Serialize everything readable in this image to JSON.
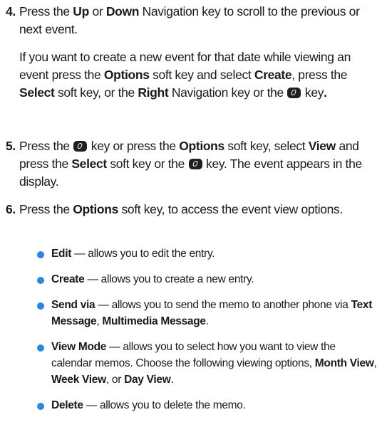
{
  "step4": {
    "num": "4.",
    "t1": "Press the ",
    "b1": "Up",
    "t2": " or ",
    "b2": "Down",
    "t3": " Navigation key to scroll to the previous or next event."
  },
  "step4_para": {
    "t1": "If you want to create a new event for that date while viewing an event press the ",
    "b1": "Options",
    "t2": " soft key and select ",
    "b2": "Create",
    "t3": ", press the ",
    "b3": "Select",
    "t4": " soft key, or the ",
    "b4": "Right",
    "t5": " Navigation key or the ",
    "t6": " key",
    "t7": "."
  },
  "step5": {
    "num": "5.",
    "t1": "Press the ",
    "t2": " key or press the ",
    "b1": "Options",
    "t3": " soft key, select ",
    "b2": "View",
    "t4": " and press the ",
    "b3": "Select",
    "t5": " soft key or the ",
    "t6": " key. The event appears in the display."
  },
  "step6": {
    "num": "6.",
    "t1": "Press the ",
    "b1": "Options",
    "t2": " soft key, to access the event view options."
  },
  "bullets": {
    "edit": {
      "b1": "Edit",
      "t1": " — allows you to edit the entry."
    },
    "create": {
      "b1": "Create",
      "t1": " — allows you to create a new entry."
    },
    "send": {
      "b1": "Send via",
      "t1": " — allows you to send the memo to another phone via ",
      "b2": "Text Message",
      "t2": ", ",
      "b3": "Multimedia Message",
      "t3": "."
    },
    "view_mode": {
      "b1": "View Mode",
      "t1": " — allows you to select how you want to view the calendar memos. Choose the following viewing options, ",
      "b2": "Month View",
      "t2": ", ",
      "b3": "Week View",
      "t3": ", or ",
      "b4": "Day View",
      "t4": "."
    },
    "delete": {
      "b1": "Delete",
      "t1": " — allows you to delete the memo."
    }
  },
  "icons": {
    "select_key": "select-key-icon",
    "bullet": "bullet-dot-icon"
  },
  "colors": {
    "bullet": "#2a86e0",
    "text": "#1a1a1a"
  }
}
